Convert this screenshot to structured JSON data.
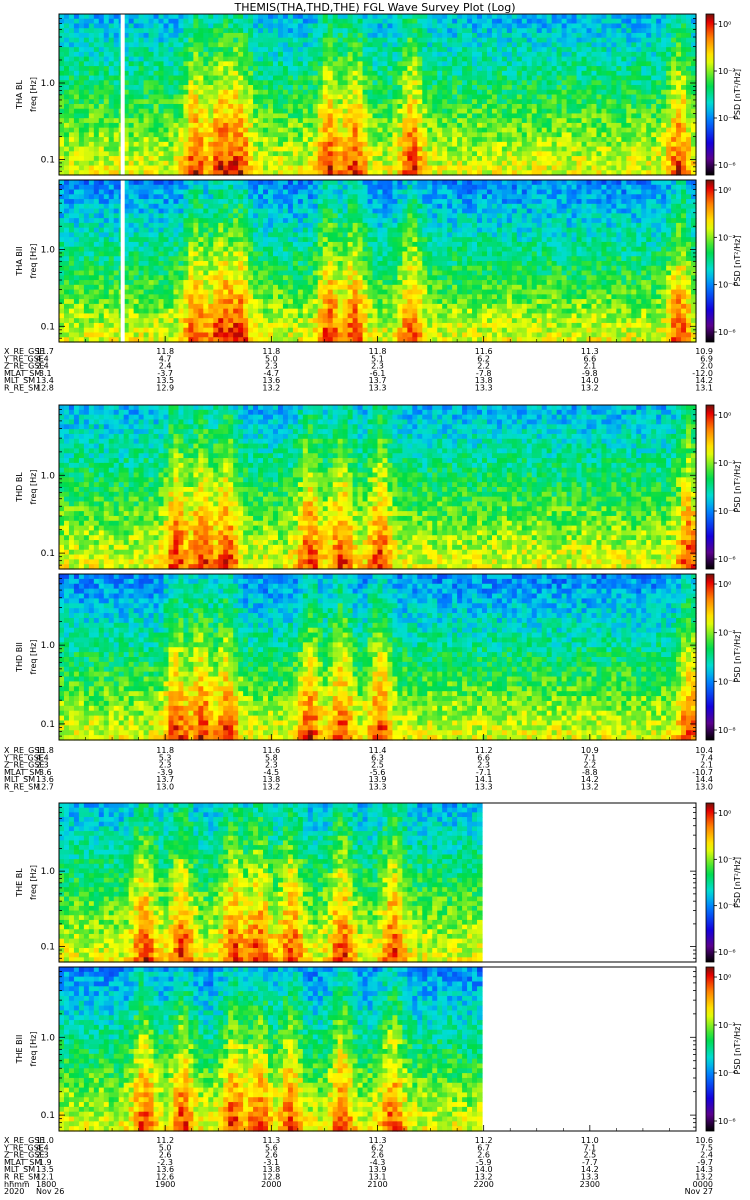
{
  "title": "THEMIS(THA,THD,THE) FGL Wave Survey Plot (Log)",
  "colors": {
    "bg": "#ffffff",
    "frame": "#000000"
  },
  "chart_data": {
    "type": "heatmap",
    "ylim_hz": [
      0.0625,
      8.0
    ],
    "y_scale": "log",
    "yticks": [
      "0.1",
      "1.0"
    ],
    "colorbar": {
      "label": "PSD [nT²/Hz]",
      "ticks": [
        "10⁰",
        "10⁻²",
        "10⁻⁴",
        "10⁻⁶"
      ],
      "ticks_alt": [
        "10⁰",
        "10⁻²",
        "10⁻⁴",
        "10⁻⁸"
      ],
      "colormap": "rainbow"
    },
    "groups": [
      {
        "probe": "THA",
        "panels": [
          {
            "ylabel": "THA BL",
            "yunit": "freq [Hz]",
            "gap_at_fraction": 0.1,
            "data_end_fraction": 1.0,
            "cb_ticks": [
              "10⁰",
              "10⁻²",
              "10⁻⁴",
              "10⁻⁶"
            ]
          },
          {
            "ylabel": "THA BII",
            "yunit": "freq [Hz]",
            "gap_at_fraction": 0.1,
            "data_end_fraction": 1.0,
            "cb_ticks": [
              "10⁰",
              "10⁻²",
              "10⁻⁴",
              "10⁻⁶"
            ]
          }
        ],
        "ephem": {
          "labels": [
            "X_RE_GSE",
            "Y_RE_GSE",
            "Z_RE_GSE",
            "MLAT_SM",
            "MLT_SM",
            "R_RE_SM"
          ],
          "columns": [
            [
              "11.7",
              "4.4",
              "2.4",
              "-3.1",
              "13.4",
              "12.8"
            ],
            [
              "11.8",
              "4.7",
              "2.4",
              "-3.7",
              "13.5",
              "12.9"
            ],
            [
              "11.8",
              "5.0",
              "2.3",
              "-4.7",
              "13.6",
              "13.2"
            ],
            [
              "11.8",
              "5.1",
              "2.3",
              "-6.1",
              "13.7",
              "13.3"
            ],
            [
              "11.6",
              "6.2",
              "2.2",
              "-7.8",
              "13.8",
              "13.3"
            ],
            [
              "11.3",
              "6.6",
              "2.1",
              "-9.8",
              "14.0",
              "13.2"
            ],
            [
              "10.9",
              "6.9",
              "2.0",
              "-12.0",
              "14.2",
              "13.1"
            ]
          ]
        }
      },
      {
        "probe": "THD",
        "panels": [
          {
            "ylabel": "THD BL",
            "yunit": "freq [Hz]",
            "gap_at_fraction": null,
            "data_end_fraction": 1.0,
            "cb_ticks": [
              "10⁰",
              "10⁻²",
              "10⁻⁴",
              "10⁻⁶"
            ]
          },
          {
            "ylabel": "THD BII",
            "yunit": "freq [Hz]",
            "gap_at_fraction": null,
            "data_end_fraction": 1.0,
            "cb_ticks": [
              "10⁰",
              "10⁻²",
              "10⁻⁴",
              "10⁻⁸"
            ]
          }
        ],
        "ephem": {
          "labels": [
            "X_RE_GSE",
            "Y_RE_GSE",
            "Z_RE_GSE",
            "MLAT_SM",
            "MLT_SM",
            "R_RE_SM"
          ],
          "columns": [
            [
              "11.8",
              "4.4",
              "2.3",
              "-3.6",
              "13.6",
              "12.7"
            ],
            [
              "11.8",
              "5.3",
              "2.3",
              "-3.9",
              "13.7",
              "13.0"
            ],
            [
              "11.6",
              "5.8",
              "2.3",
              "-4.5",
              "13.8",
              "13.2"
            ],
            [
              "11.4",
              "6.3",
              "2.5",
              "-5.6",
              "13.9",
              "13.3"
            ],
            [
              "11.2",
              "6.6",
              "2.3",
              "-7.1",
              "14.1",
              "13.3"
            ],
            [
              "10.9",
              "7.1",
              "2.2",
              "-8.8",
              "14.2",
              "13.2"
            ],
            [
              "10.4",
              "7.4",
              "2.1",
              "-10.7",
              "14.4",
              "13.0"
            ]
          ]
        }
      },
      {
        "probe": "THE",
        "panels": [
          {
            "ylabel": "THE BL",
            "yunit": "freq [Hz]",
            "gap_at_fraction": null,
            "data_end_fraction": 0.667,
            "cb_ticks": [
              "10⁰",
              "10⁻²",
              "10⁻⁴",
              "10⁻⁶"
            ]
          },
          {
            "ylabel": "THE BII",
            "yunit": "freq [Hz]",
            "gap_at_fraction": null,
            "data_end_fraction": 0.667,
            "cb_ticks": [
              "10⁰",
              "10⁻²",
              "10⁻⁴",
              "10⁻⁶"
            ]
          }
        ],
        "ephem": {
          "labels": [
            "X_RE_GSE",
            "Y_RE_GSE",
            "Z_RE_GSE",
            "MLAT_SM",
            "MLT_SM",
            "R_RE_SM",
            "hhmm",
            "2020"
          ],
          "columns": [
            [
              "11.0",
              "4.4",
              "2.3",
              "-1.9",
              "13.5",
              "12.1",
              "1800",
              "Nov 26"
            ],
            [
              "11.2",
              "5.0",
              "2.6",
              "-2.3",
              "13.6",
              "12.6",
              "1900",
              ""
            ],
            [
              "11.3",
              "5.6",
              "2.6",
              "-3.1",
              "13.8",
              "12.8",
              "2000",
              ""
            ],
            [
              "11.3",
              "6.2",
              "2.6",
              "-4.3",
              "13.9",
              "13.1",
              "2100",
              ""
            ],
            [
              "11.2",
              "6.7",
              "2.6",
              "-5.9",
              "14.0",
              "13.2",
              "2200",
              ""
            ],
            [
              "11.0",
              "7.1",
              "2.5",
              "-7.7",
              "14.2",
              "13.3",
              "2300",
              ""
            ],
            [
              "10.6",
              "7.5",
              "2.4",
              "-9.7",
              "14.3",
              "13.2",
              "0000",
              "Nov 27"
            ]
          ]
        }
      }
    ]
  }
}
